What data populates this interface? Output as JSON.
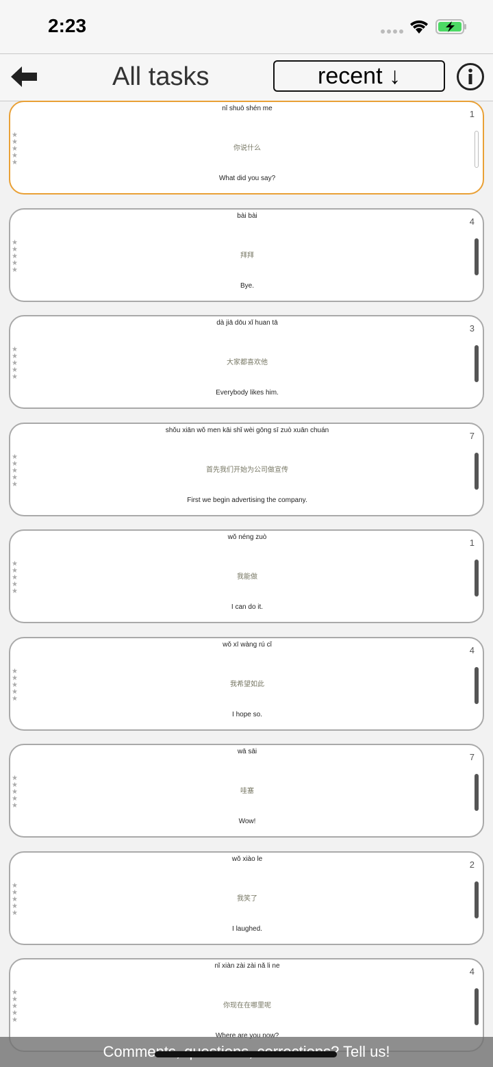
{
  "status": {
    "time": "2:23"
  },
  "header": {
    "title": "All tasks",
    "sort_label": "recent ↓"
  },
  "tasks": [
    {
      "pinyin": "nǐ shuō shén me",
      "hanzi": "你说什么",
      "english": "What did you say?",
      "count": "1",
      "stars": "★★★★★"
    },
    {
      "pinyin": "bài bài",
      "hanzi": "拜拜",
      "english": "Bye.",
      "count": "4",
      "stars": "★★★★★"
    },
    {
      "pinyin": "dà jiā dōu xǐ huan tā",
      "hanzi": "大家都喜欢他",
      "english": "Everybody likes him.",
      "count": "3",
      "stars": "★★★★★"
    },
    {
      "pinyin": "shǒu xiān wǒ men kāi shǐ wèi gōng sī zuò xuān chuán",
      "hanzi": "首先我们开始为公司做宣传",
      "english": "First we begin advertising the company.",
      "count": "7",
      "stars": "★★★★★"
    },
    {
      "pinyin": "wǒ néng zuò",
      "hanzi": "我能做",
      "english": "I can do it.",
      "count": "1",
      "stars": "★★★★★"
    },
    {
      "pinyin": "wǒ xī wàng rú cǐ",
      "hanzi": "我希望如此",
      "english": "I hope so.",
      "count": "4",
      "stars": "★★★★★"
    },
    {
      "pinyin": "wā sāi",
      "hanzi": "哇塞",
      "english": "Wow!",
      "count": "7",
      "stars": "★★★★★"
    },
    {
      "pinyin": "wǒ xiào le",
      "hanzi": "我笑了",
      "english": "I laughed.",
      "count": "2",
      "stars": "★★★★★"
    },
    {
      "pinyin": "nǐ xiàn zài zài nǎ li ne",
      "hanzi": "你现在在哪里呢",
      "english": "Where are you now?",
      "count": "4",
      "stars": "★★★★★"
    }
  ],
  "feedback": {
    "label": "Comments, questions, corrections? Tell us!"
  },
  "colors": {
    "selected_border": "#e9a035",
    "hanzi": "#777764",
    "battery": "#4cd964"
  }
}
